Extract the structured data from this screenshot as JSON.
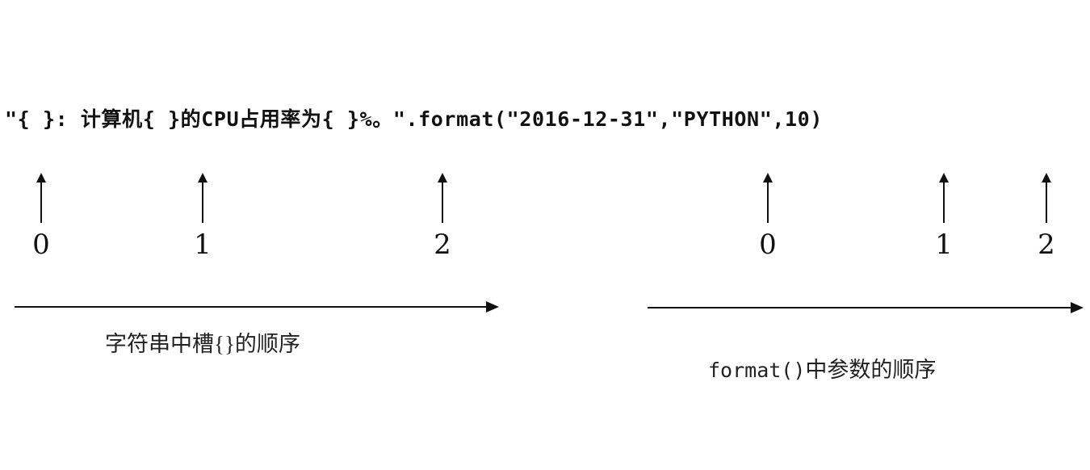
{
  "code_line": "\"{ }: 计算机{ }的CPU占用率为{ }%。\".format(\"2016-12-31\",\"PYTHON\",10)",
  "slot_indices": [
    "0",
    "1",
    "2"
  ],
  "arg_indices": [
    "0",
    "1",
    "2"
  ],
  "captions": {
    "left": "字符串中槽{}的顺序",
    "right_code": "format()",
    "right_text": "中参数的顺序"
  },
  "colors": {
    "ink": "#111111",
    "background": "#ffffff"
  },
  "icons": [
    "arrow-up-icon",
    "arrow-right-icon"
  ]
}
